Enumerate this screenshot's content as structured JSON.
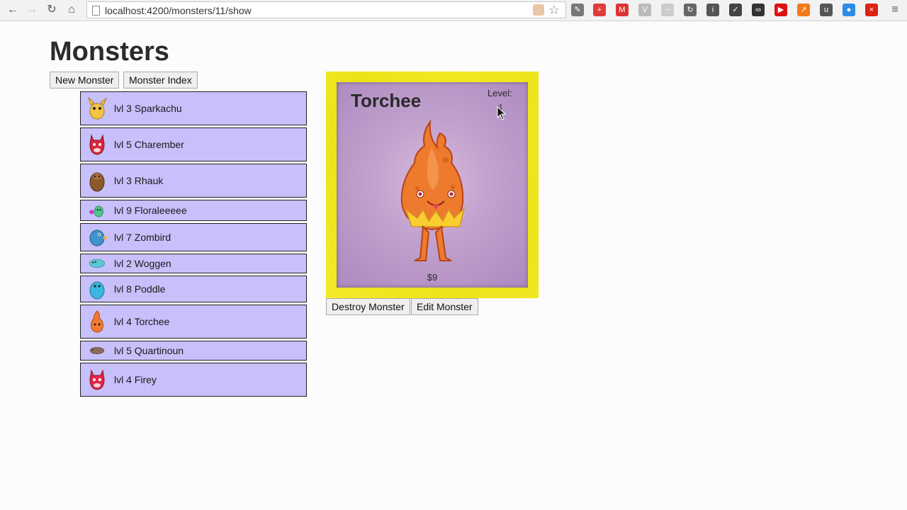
{
  "browser": {
    "url": "localhost:4200/monsters/11/show"
  },
  "page": {
    "title": "Monsters",
    "new_button": "New Monster",
    "index_button": "Monster Index"
  },
  "monsters": [
    {
      "label": "lvl 3 Sparkachu",
      "icon": "sparkachu-icon"
    },
    {
      "label": "lvl 5 Charember",
      "icon": "charember-icon"
    },
    {
      "label": "lvl 3 Rhauk",
      "icon": "rhauk-icon"
    },
    {
      "label": "lvl 9 Floraleeeee",
      "icon": "floraleeeee-icon"
    },
    {
      "label": "lvl 7 Zombird",
      "icon": "zombird-icon"
    },
    {
      "label": "lvl 2 Woggen",
      "icon": "woggen-icon"
    },
    {
      "label": "lvl 8 Poddle",
      "icon": "poddle-icon"
    },
    {
      "label": "lvl 4 Torchee",
      "icon": "torchee-icon"
    },
    {
      "label": "lvl 5 Quartinoun",
      "icon": "quartinoun-icon"
    },
    {
      "label": "lvl 4 Firey",
      "icon": "firey-icon"
    }
  ],
  "detail": {
    "name": "Torchee",
    "level_label": "Level:",
    "level": "4",
    "price": "$9",
    "destroy_button": "Destroy Monster",
    "edit_button": "Edit Monster"
  },
  "colors": {
    "row_background": "#c7c0fa",
    "card_frame": "#f0e620",
    "card_background": "#c0a0cc"
  }
}
